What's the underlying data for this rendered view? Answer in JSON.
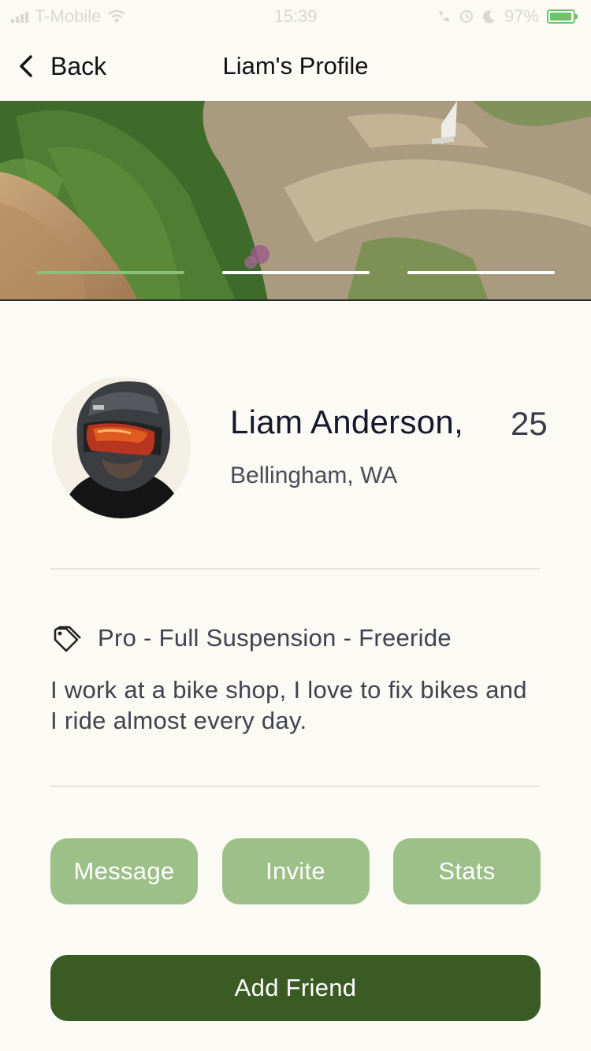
{
  "status_bar": {
    "carrier": "T-Mobile",
    "time": "15:39",
    "battery": "97%",
    "battery_level": 0.97
  },
  "nav": {
    "back_label": "Back",
    "title": "Liam's Profile"
  },
  "gallery": {
    "page_count": 3,
    "active_index": 0
  },
  "profile": {
    "name": "Liam Anderson,",
    "age": "25",
    "location": "Bellingham, WA",
    "tag_text": "Pro - Full Suspension - Freeride",
    "bio": "I work at a bike shop, I love to fix bikes and I ride almost every day."
  },
  "actions": {
    "message": "Message",
    "invite": "Invite",
    "stats": "Stats",
    "add_friend": "Add Friend"
  },
  "colors": {
    "background": "#fbfaf5",
    "secondary_button": "#9cc087",
    "primary_button": "#3b5b25",
    "indicator_active": "#8bbf7a"
  }
}
